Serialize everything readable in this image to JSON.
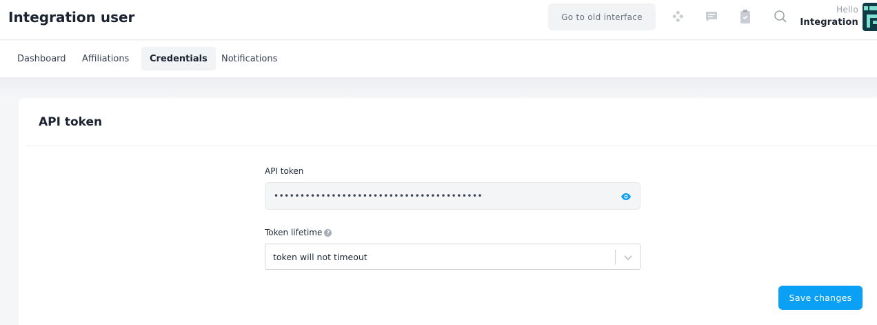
{
  "header": {
    "title": "Integration user",
    "old_interface_label": "Go to old interface",
    "greeting": "Hello",
    "user_name": "Integration",
    "icons": [
      "apps-icon",
      "chat-icon",
      "clipboard-icon",
      "search-icon"
    ]
  },
  "tabs": [
    {
      "label": "Dashboard",
      "active": false
    },
    {
      "label": "Affiliations",
      "active": false
    },
    {
      "label": "Credentials",
      "active": true
    },
    {
      "label": "Notifications",
      "active": false
    }
  ],
  "card": {
    "title": "API token",
    "token_label": "API token",
    "token_value": "••••••••••••••••••••••••••••••••••••••••",
    "lifetime_label": "Token lifetime",
    "lifetime_value": "token will not timeout",
    "save_label": "Save changes"
  },
  "colors": {
    "accent": "#0aa0f5",
    "avatar_bg": "#0f3b47",
    "avatar_fg": "#7fe0d0"
  }
}
